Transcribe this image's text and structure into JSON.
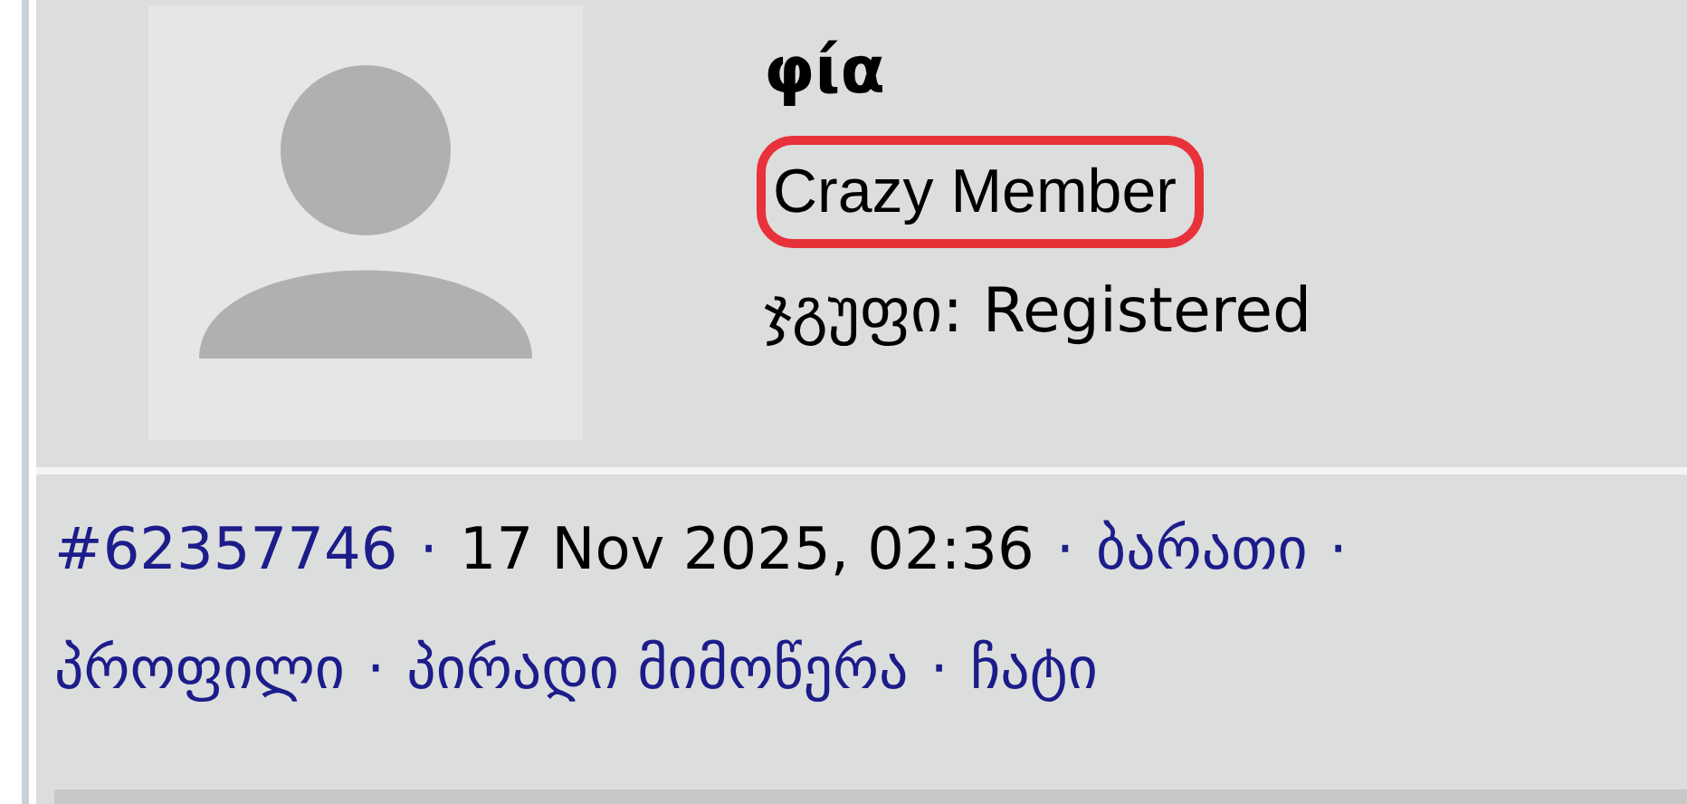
{
  "profile": {
    "name": "φία",
    "rank": "Crazy Member",
    "rank_highlighted": true,
    "group": "ჯგუფი: Registered"
  },
  "post_meta": {
    "lines": [
      [
        {
          "kind": "link",
          "text": "#62357746"
        },
        {
          "kind": "separator",
          "text": "·"
        },
        {
          "kind": "plain",
          "text": "17 Nov 2025, 02:36"
        },
        {
          "kind": "separator",
          "text": "·"
        },
        {
          "kind": "link",
          "text": "ბარათი"
        },
        {
          "kind": "separator",
          "text": "·"
        }
      ],
      [
        {
          "kind": "link",
          "text": "პროფილი"
        },
        {
          "kind": "separator",
          "text": "·"
        },
        {
          "kind": "link",
          "text": "პირადი მიმოწერა"
        },
        {
          "kind": "separator",
          "text": "·"
        },
        {
          "kind": "link",
          "text": "ჩატი"
        }
      ]
    ]
  }
}
